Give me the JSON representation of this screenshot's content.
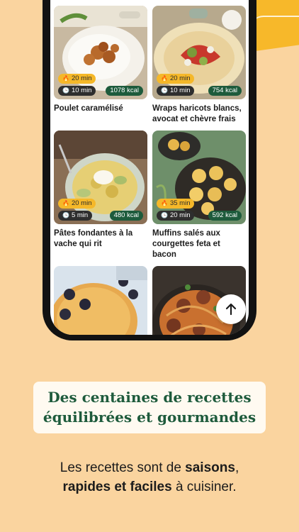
{
  "recipes": [
    {
      "title": "Poulet caramélisé",
      "prep": "20 min",
      "cook": "10 min",
      "kcal": "1078 kcal"
    },
    {
      "title": "Wraps haricots blancs, avocat et chèvre frais",
      "prep": "20 min",
      "cook": "10 min",
      "kcal": "754 kcal"
    },
    {
      "title": "Pâtes fondantes à la vache qui rit",
      "prep": "20 min",
      "cook": "5 min",
      "kcal": "480 kcal"
    },
    {
      "title": "Muffins salés aux courgettes feta et bacon",
      "prep": "35 min",
      "cook": "20 min",
      "kcal": "592 kcal"
    },
    {
      "title": "",
      "prep": "",
      "cook": "",
      "kcal": ""
    },
    {
      "title": "",
      "prep": "",
      "cook": "",
      "kcal": ""
    }
  ],
  "icons": {
    "prep": "flame-icon",
    "cook": "clock-icon",
    "fab": "arrow-up-icon"
  },
  "colors": {
    "background": "#fad49f",
    "accent_green": "#1e5b3c",
    "accent_yellow": "#f5b829"
  },
  "headline": {
    "line1": "Des centaines de recettes",
    "line2": "équilibrées et gourmandes"
  },
  "subtitle": {
    "part1": "Les recettes sont de ",
    "bold1": "saisons",
    "part2": ",",
    "bold2": "rapides et faciles",
    "part3": " à cuisiner."
  }
}
